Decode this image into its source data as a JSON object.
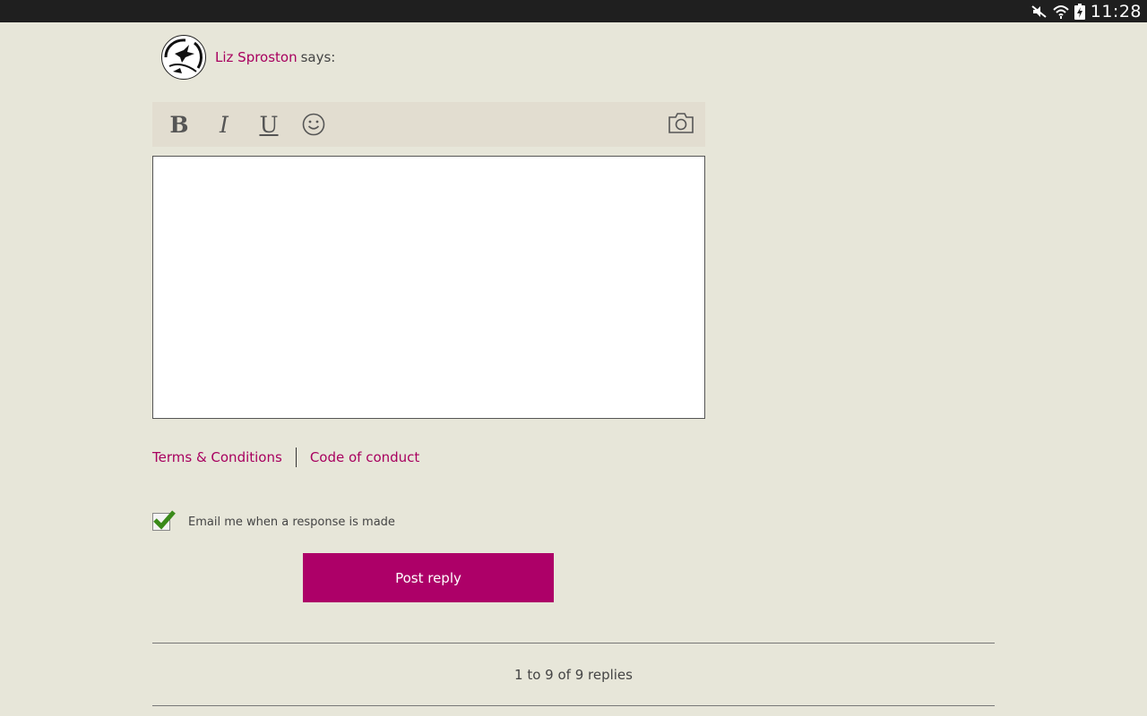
{
  "status_bar": {
    "time": "11:28",
    "icons": [
      "mute-icon",
      "wifi-icon",
      "battery-charging-icon"
    ]
  },
  "comment": {
    "author_name": "Liz Sproston",
    "says_label": "says:"
  },
  "toolbar": {
    "bold_label": "B",
    "italic_label": "I",
    "underline_label": "U",
    "emoji_icon": "smiley-icon",
    "photo_icon": "camera-icon"
  },
  "editor": {
    "value": ""
  },
  "links": {
    "terms_label": "Terms & Conditions",
    "conduct_label": "Code of conduct"
  },
  "email_option": {
    "label": "Email me when a response is made",
    "checked": true
  },
  "post_button_label": "Post reply",
  "replies": {
    "count_text": "1 to 9 of 9 replies"
  },
  "colors": {
    "accent": "#ad0068",
    "link": "#a8005f",
    "background": "#e7e6d9",
    "toolbar_bg": "#e2ddd0",
    "check": "#3a8a1a"
  }
}
